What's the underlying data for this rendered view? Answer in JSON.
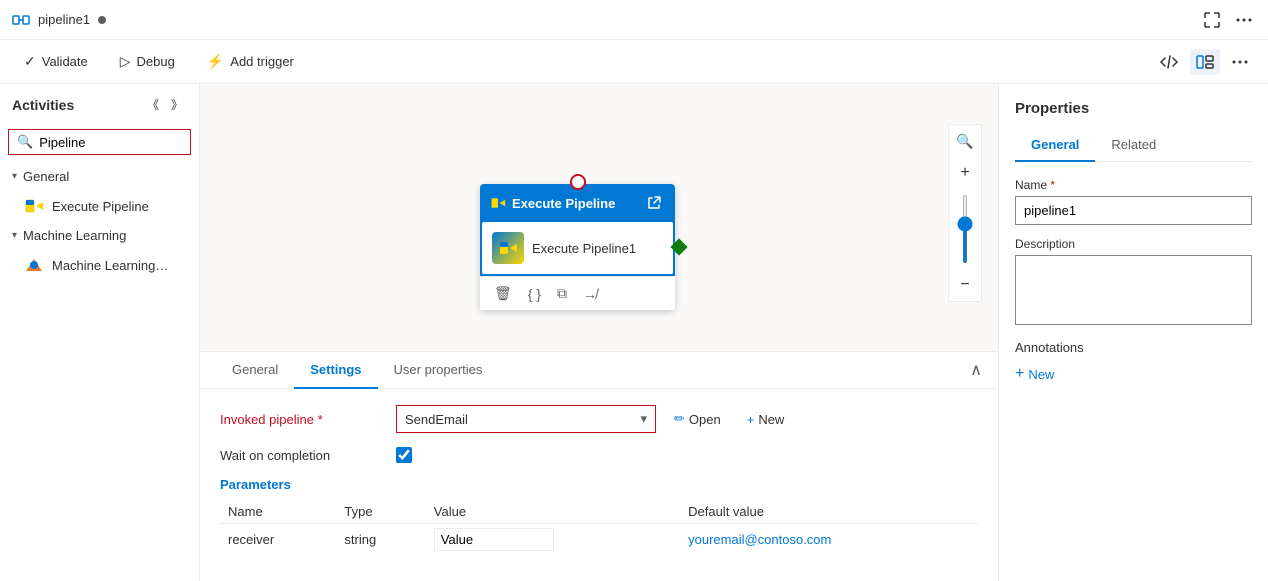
{
  "topbar": {
    "title": "pipeline1",
    "dot_color": "#605e5c"
  },
  "toolbar": {
    "validate_label": "Validate",
    "debug_label": "Debug",
    "add_trigger_label": "Add trigger"
  },
  "sidebar": {
    "title": "Activities",
    "search_placeholder": "Pipeline",
    "search_value": "Pipeline",
    "sections": [
      {
        "id": "general",
        "label": "General",
        "expanded": true,
        "items": [
          {
            "id": "execute-pipeline",
            "label": "Execute Pipeline",
            "icon": "pipeline"
          }
        ]
      },
      {
        "id": "machine-learning",
        "label": "Machine Learning",
        "expanded": true,
        "items": [
          {
            "id": "ml-execute",
            "label": "Machine Learning Exe...",
            "icon": "ml"
          }
        ]
      }
    ]
  },
  "canvas": {
    "node": {
      "title": "Execute Pipeline",
      "label": "Execute Pipeline1"
    }
  },
  "bottom_panel": {
    "tabs": [
      {
        "id": "general",
        "label": "General"
      },
      {
        "id": "settings",
        "label": "Settings",
        "active": true
      },
      {
        "id": "user-properties",
        "label": "User properties"
      }
    ],
    "settings": {
      "invoked_pipeline_label": "Invoked pipeline",
      "invoked_pipeline_required": "*",
      "invoked_pipeline_value": "SendEmail",
      "open_label": "Open",
      "new_label": "New",
      "wait_on_completion_label": "Wait on completion",
      "wait_checked": true,
      "parameters_title": "Parameters",
      "param_columns": [
        "Name",
        "Type",
        "Value",
        "Default value"
      ],
      "parameters": [
        {
          "name": "receiver",
          "type": "string",
          "value": "Value",
          "default_value": "youremail@contoso.com"
        }
      ]
    }
  },
  "properties": {
    "title": "Properties",
    "tabs": [
      {
        "id": "general",
        "label": "General",
        "active": true
      },
      {
        "id": "related",
        "label": "Related"
      }
    ],
    "name_label": "Name",
    "name_required": "*",
    "name_value": "pipeline1",
    "description_label": "Description",
    "description_value": "",
    "annotations_label": "Annotations",
    "add_new_label": "New"
  }
}
